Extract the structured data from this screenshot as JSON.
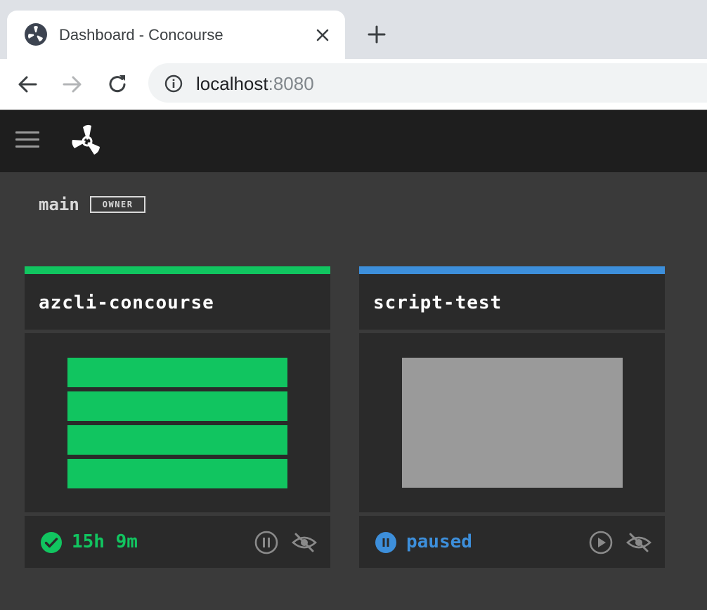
{
  "browser": {
    "tab_title": "Dashboard - Concourse",
    "url_host": "localhost",
    "url_port": ":8080"
  },
  "icons": {
    "favicon": "concourse-logo-icon",
    "tab_close": "close-icon",
    "new_tab": "plus-icon",
    "back": "arrow-left-icon",
    "forward": "arrow-right-icon",
    "reload": "reload-icon",
    "site_info": "info-icon",
    "menu": "hamburger-menu-icon",
    "app_logo": "concourse-logo-icon"
  },
  "team": {
    "name": "main",
    "role_badge": "OWNER"
  },
  "pipelines": [
    {
      "name": "azcli-concourse",
      "banner_color": "#11c560",
      "status": "succeeded",
      "status_text": "15h 9m",
      "status_color": "#11c560",
      "job_count": 4,
      "status_icon": "check-circle-icon",
      "action_icon": "pause-circle-icon",
      "visibility_icon": "eye-off-icon"
    },
    {
      "name": "script-test",
      "banner_color": "#3d8fdb",
      "status": "paused",
      "status_text": "paused",
      "status_color": "#3d8fdb",
      "status_icon": "pause-circle-icon",
      "action_icon": "play-circle-icon",
      "visibility_icon": "eye-off-icon"
    }
  ]
}
